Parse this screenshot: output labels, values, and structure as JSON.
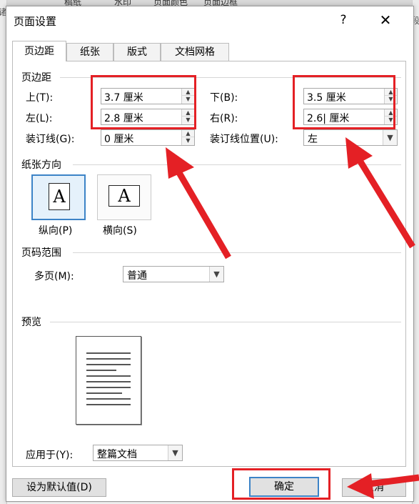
{
  "background_doc": {
    "ribbon_items": [
      "稿纸",
      "水印",
      "页面颜色",
      "页面边框"
    ],
    "side_glyph_left": "诸",
    "side_glyph_right": "段"
  },
  "dialog": {
    "title": "页面设置",
    "help_label": "?",
    "close_label": "✕"
  },
  "tabs": [
    {
      "label": "页边距",
      "active": true
    },
    {
      "label": "纸张",
      "active": false
    },
    {
      "label": "版式",
      "active": false
    },
    {
      "label": "文档网格",
      "active": false
    }
  ],
  "margins": {
    "section_label": "页边距",
    "top": {
      "label": "上(T):",
      "value": "3.7 厘米"
    },
    "bottom": {
      "label": "下(B):",
      "value": "3.5 厘米"
    },
    "left": {
      "label": "左(L):",
      "value": "2.8 厘米"
    },
    "right": {
      "label": "右(R):",
      "value": "2.6| 厘米"
    },
    "gutter": {
      "label": "装订线(G):",
      "value": "0 厘米"
    },
    "gutter_position": {
      "label": "装订线位置(U):",
      "value": "左"
    }
  },
  "orientation": {
    "section_label": "纸张方向",
    "glyph": "A",
    "portrait_label": "纵向(P)",
    "landscape_label": "横向(S)",
    "selected": "portrait"
  },
  "pages": {
    "section_label": "页码范围",
    "multiple_label": "多页(M):",
    "multiple_value": "普通"
  },
  "preview": {
    "section_label": "预览",
    "apply_label": "应用于(Y):",
    "apply_value": "整篇文档"
  },
  "buttons": {
    "set_default": "设为默认值(D)",
    "ok": "确定",
    "cancel_partial": "取消"
  },
  "annotation_color": "#e42025",
  "accent_color": "#3c83c7",
  "arrow_glyph": "▲"
}
